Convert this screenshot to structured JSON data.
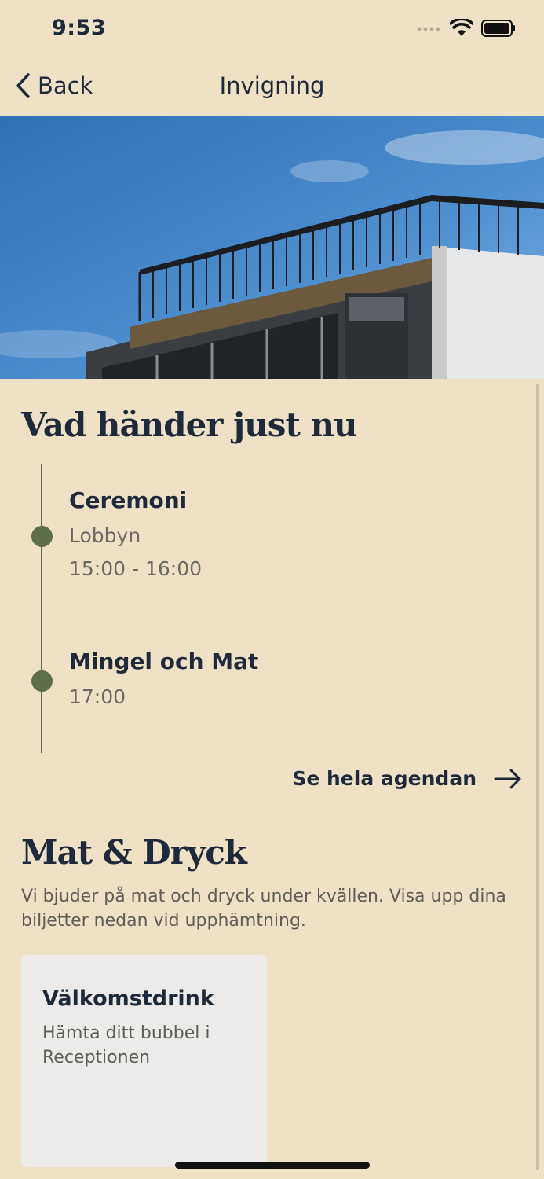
{
  "status": {
    "time": "9:53"
  },
  "nav": {
    "back_label": "Back",
    "title": "Invigning"
  },
  "now": {
    "title": "Vad händer just nu",
    "events": [
      {
        "title": "Ceremoni",
        "location": "Lobbyn",
        "time": "15:00 - 16:00"
      },
      {
        "title": "Mingel och Mat",
        "time": "17:00"
      }
    ],
    "agenda_link": "Se hela agendan"
  },
  "food": {
    "title": "Mat & Dryck",
    "intro": "Vi bjuder på mat och dryck under kvällen. Visa upp dina biljetter nedan vid upphämtning.",
    "cards": [
      {
        "title": "Välkomstdrink",
        "description": "Hämta ditt bubbel i Receptionen"
      }
    ]
  },
  "colors": {
    "background": "#efe1c6",
    "accent": "#5e6e4c",
    "text": "#1e2a3b",
    "card": "#ecebea"
  }
}
